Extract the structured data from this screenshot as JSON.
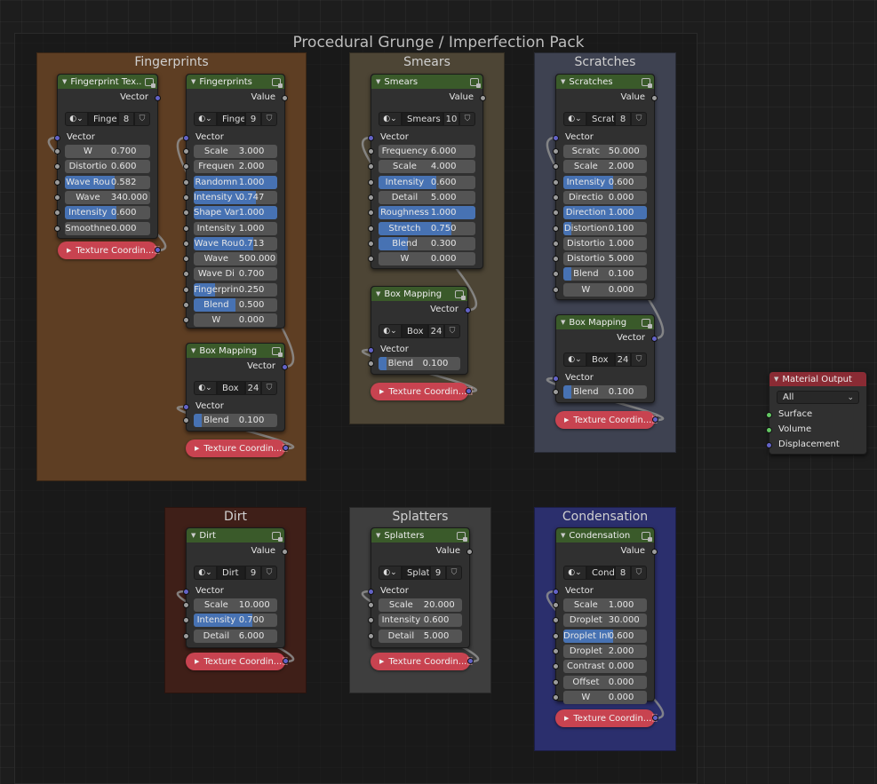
{
  "pack_title": "Procedural Grunge / Imperfection Pack",
  "colors": {
    "group_header": "#3a5a2a",
    "texcoord_node": "#c84350",
    "material_output_header": "#8a2b34",
    "slider_fill": "#4772b3",
    "vector_socket": "#6363c7",
    "shader_socket": "#63c763",
    "float_socket": "#9c9c9c"
  },
  "frames": {
    "fingerprints": {
      "title": "Fingerprints",
      "color": "#5e3e23"
    },
    "smears": {
      "title": "Smears",
      "color": "#4d4535"
    },
    "scratches": {
      "title": "Scratches",
      "color": "#3e4251"
    },
    "dirt": {
      "title": "Dirt",
      "color": "#3f1f18"
    },
    "splatters": {
      "title": "Splatters",
      "color": "#3e3e3e"
    },
    "condensation": {
      "title": "Condensation",
      "color": "#2b2f6d"
    }
  },
  "nodes": {
    "fp_tex": {
      "title": "Fingerprint Tex...",
      "output": "Vector",
      "datablock": "Finger",
      "users": "8",
      "vector_in": "Vector",
      "fields": [
        {
          "label": "W",
          "value": "0.700",
          "fill": 0
        },
        {
          "label": "Distortio",
          "value": "0.600",
          "fill": 0
        },
        {
          "label": "Wave Rou",
          "value": "0.582",
          "fill": 0.582
        },
        {
          "label": "Wave",
          "value": "340.000",
          "fill": 0
        },
        {
          "label": "Intensity",
          "value": "0.600",
          "fill": 0.6
        },
        {
          "label": "Smoothne",
          "value": "0.000",
          "fill": 0
        }
      ]
    },
    "fp_main": {
      "title": "Fingerprints",
      "output": "Value",
      "datablock": "Finger",
      "users": "9",
      "vector_in": "Vector",
      "fields": [
        {
          "label": "Scale",
          "value": "3.000",
          "fill": 0
        },
        {
          "label": "Frequen",
          "value": "2.000",
          "fill": 0
        },
        {
          "label": "Randomn",
          "value": "1.000",
          "fill": 1
        },
        {
          "label": "Intensity V",
          "value": "0.747",
          "fill": 0.747
        },
        {
          "label": "Shape Var",
          "value": "1.000",
          "fill": 1
        },
        {
          "label": "Intensity",
          "value": "1.000",
          "fill": 0
        },
        {
          "label": "Wave Rou",
          "value": "0.713",
          "fill": 0.713
        },
        {
          "label": "Wave",
          "value": "500.000",
          "fill": 0
        },
        {
          "label": "Wave Di",
          "value": "0.700",
          "fill": 0
        },
        {
          "label": "Fingerprin",
          "value": "0.250",
          "fill": 0.25
        },
        {
          "label": "Blend",
          "value": "0.500",
          "fill": 0.5
        },
        {
          "label": "W",
          "value": "0.000",
          "fill": 0
        }
      ]
    },
    "fp_box": {
      "title": "Box Mapping",
      "output": "Vector",
      "datablock": "Box",
      "users": "24",
      "vector_in": "Vector",
      "fields": [
        {
          "label": "Blend",
          "value": "0.100",
          "fill": 0.1
        }
      ]
    },
    "fp_tc1": {
      "label": "Texture Coordin..."
    },
    "fp_tc2": {
      "label": "Texture Coordin..."
    },
    "sm_main": {
      "title": "Smears",
      "output": "Value",
      "datablock": "Smears",
      "users": "10",
      "vector_in": "Vector",
      "fields": [
        {
          "label": "Frequency",
          "value": "6.000",
          "fill": 0
        },
        {
          "label": "Scale",
          "value": "4.000",
          "fill": 0
        },
        {
          "label": "Intensity",
          "value": "0.600",
          "fill": 0.6
        },
        {
          "label": "Detail",
          "value": "5.000",
          "fill": 0
        },
        {
          "label": "Roughness",
          "value": "1.000",
          "fill": 1
        },
        {
          "label": "Stretch",
          "value": "0.750",
          "fill": 0.75
        },
        {
          "label": "Blend",
          "value": "0.300",
          "fill": 0.3
        },
        {
          "label": "W",
          "value": "0.000",
          "fill": 0
        }
      ]
    },
    "sm_box": {
      "title": "Box Mapping",
      "output": "Vector",
      "datablock": "Box",
      "users": "24",
      "vector_in": "Vector",
      "fields": [
        {
          "label": "Blend",
          "value": "0.100",
          "fill": 0.1
        }
      ]
    },
    "sm_tc": {
      "label": "Texture Coordin..."
    },
    "sc_main": {
      "title": "Scratches",
      "output": "Value",
      "datablock": "Scrat",
      "users": "8",
      "vector_in": "Vector",
      "fields": [
        {
          "label": "Scratc",
          "value": "50.000",
          "fill": 0
        },
        {
          "label": "Scale",
          "value": "2.000",
          "fill": 0
        },
        {
          "label": "Intensity",
          "value": "0.600",
          "fill": 0.6
        },
        {
          "label": "Directio",
          "value": "0.000",
          "fill": 0
        },
        {
          "label": "Direction",
          "value": "1.000",
          "fill": 1
        },
        {
          "label": "Distortion",
          "value": "0.100",
          "fill": 0.1
        },
        {
          "label": "Distortio",
          "value": "1.000",
          "fill": 0
        },
        {
          "label": "Distortio",
          "value": "5.000",
          "fill": 0
        },
        {
          "label": "Blend",
          "value": "0.100",
          "fill": 0.1
        },
        {
          "label": "W",
          "value": "0.000",
          "fill": 0
        }
      ]
    },
    "sc_box": {
      "title": "Box Mapping",
      "output": "Vector",
      "datablock": "Box",
      "users": "24",
      "vector_in": "Vector",
      "fields": [
        {
          "label": "Blend",
          "value": "0.100",
          "fill": 0.1
        }
      ]
    },
    "sc_tc": {
      "label": "Texture Coordin..."
    },
    "dirt_main": {
      "title": "Dirt",
      "output": "Value",
      "datablock": "Dirt",
      "users": "9",
      "vector_in": "Vector",
      "fields": [
        {
          "label": "Scale",
          "value": "10.000",
          "fill": 0
        },
        {
          "label": "Intensity",
          "value": "0.700",
          "fill": 0.7
        },
        {
          "label": "Detail",
          "value": "6.000",
          "fill": 0
        }
      ]
    },
    "dirt_tc": {
      "label": "Texture Coordin..."
    },
    "sp_main": {
      "title": "Splatters",
      "output": "Value",
      "datablock": "Splatt",
      "users": "9",
      "vector_in": "Vector",
      "fields": [
        {
          "label": "Scale",
          "value": "20.000",
          "fill": 0
        },
        {
          "label": "Intensity",
          "value": "0.600",
          "fill": 0
        },
        {
          "label": "Detail",
          "value": "5.000",
          "fill": 0
        }
      ]
    },
    "sp_tc": {
      "label": "Texture Coordin..."
    },
    "co_main": {
      "title": "Condensation",
      "output": "Value",
      "datablock": "Cond",
      "users": "8",
      "vector_in": "Vector",
      "fields": [
        {
          "label": "Scale",
          "value": "1.000",
          "fill": 0
        },
        {
          "label": "Droplet",
          "value": "30.000",
          "fill": 0
        },
        {
          "label": "Droplet Int",
          "value": "0.600",
          "fill": 0.6
        },
        {
          "label": "Droplet",
          "value": "2.000",
          "fill": 0
        },
        {
          "label": "Contrast",
          "value": "0.000",
          "fill": 0
        },
        {
          "label": "Offset",
          "value": "0.000",
          "fill": 0
        },
        {
          "label": "W",
          "value": "0.000",
          "fill": 0
        }
      ]
    },
    "co_tc": {
      "label": "Texture Coordin..."
    }
  },
  "material_output": {
    "title": "Material Output",
    "target": "All",
    "inputs": [
      "Surface",
      "Volume",
      "Displacement"
    ]
  }
}
